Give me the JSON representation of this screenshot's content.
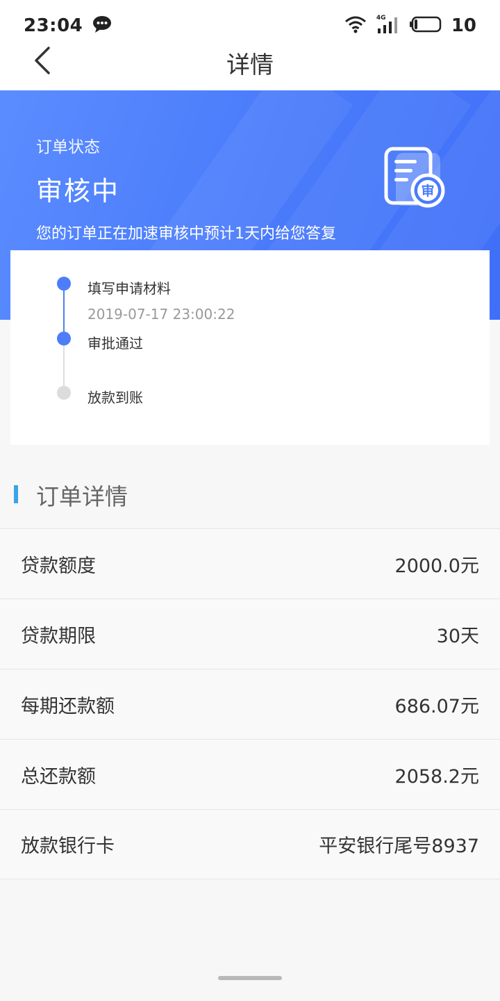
{
  "status_bar": {
    "time": "23:04",
    "network": "4G",
    "battery": "10",
    "icons": [
      "chat-bubble-icon",
      "wifi-icon",
      "signal-icon",
      "battery-icon"
    ]
  },
  "header": {
    "title": "详情",
    "back_icon": "chevron-left-icon"
  },
  "banner": {
    "label": "订单状态",
    "status": "审核中",
    "description": "您的订单正在加速审核中预计1天内给您答复",
    "icon_char": "审",
    "colors": {
      "start": "#5b8cff",
      "end": "#3f6ff8"
    }
  },
  "timeline": {
    "steps": [
      {
        "label": "填写申请材料",
        "time": "2019-07-17 23:00:22",
        "state": "done"
      },
      {
        "label": "审批通过",
        "time": "",
        "state": "done"
      },
      {
        "label": "放款到账",
        "time": "",
        "state": "pending"
      }
    ],
    "active_color": "#4d7df9",
    "inactive_color": "#dcdcdc"
  },
  "details": {
    "title": "订单详情",
    "rows": [
      {
        "label": "贷款额度",
        "value": "2000.0元"
      },
      {
        "label": "贷款期限",
        "value": "30天"
      },
      {
        "label": "每期还款额",
        "value": "686.07元"
      },
      {
        "label": "总还款额",
        "value": "2058.2元"
      },
      {
        "label": "放款银行卡",
        "value": "平安银行尾号8937"
      }
    ]
  }
}
